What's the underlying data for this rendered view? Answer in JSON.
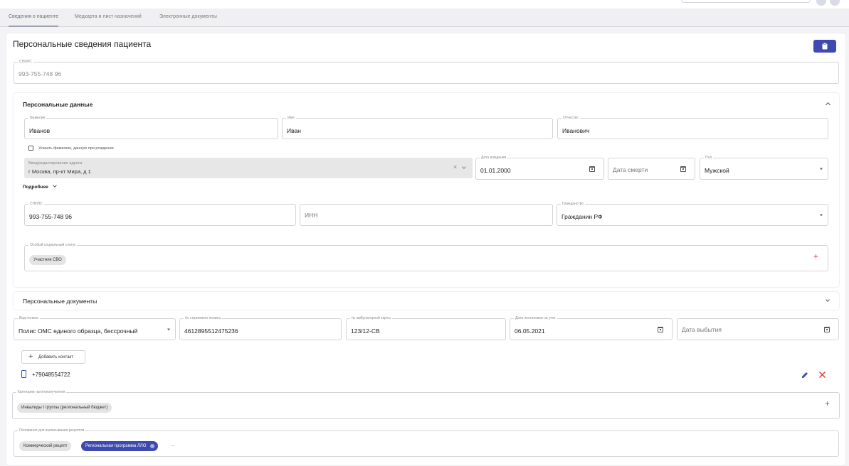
{
  "tabs": [
    "Сведения о пациенте",
    "Медкарта и лист назначений",
    "Электронные документы"
  ],
  "page_title": "Персональные сведения пациента",
  "snils_top": {
    "label": "СНИЛС",
    "value": "993-755-748 96"
  },
  "personal_data": {
    "title": "Персональные данные",
    "surname": {
      "label": "Фамилия",
      "value": "Иванов"
    },
    "name": {
      "label": "Имя",
      "value": "Иван"
    },
    "patronymic": {
      "label": "Отчество",
      "value": "Иванович"
    },
    "birth_name_checkbox": "Указать фамилию, данную при рождении",
    "address": {
      "label": "Ввод/редактирование адреса",
      "value": "г Москва, пр-кт Мира, д 1"
    },
    "birth_date": {
      "label": "Дата рождения",
      "value": "01.01.2000"
    },
    "death_date": {
      "placeholder": "Дата смерти"
    },
    "gender": {
      "label": "Пол",
      "value": "Мужской"
    },
    "more_link": "Подробнее",
    "snils": {
      "label": "СНИЛС",
      "value": "993-755-748 96"
    },
    "inn": {
      "placeholder": "ИНН"
    },
    "citizenship": {
      "label": "Гражданство",
      "value": "Гражданин РФ"
    },
    "social_status": {
      "label": "Особый социальный статус",
      "chips": [
        "Участник СВО"
      ]
    }
  },
  "documents": {
    "title": "Персональные документы"
  },
  "policy": {
    "type": {
      "label": "Вид полиса",
      "value": "Полис ОМС единого образца, бессрочный"
    },
    "number": {
      "label": "№ страхового полиса",
      "value": "4612895512475236"
    },
    "card": {
      "label": "№ амбулаторной карты",
      "value": "123/12-СВ"
    },
    "reg_date": {
      "label": "Дата постановки на учет",
      "value": "06.05.2021"
    },
    "leave_date": {
      "placeholder": "Дата выбытия"
    }
  },
  "add_contact": "Добавить контакт",
  "contact_phone": "+79048554722",
  "benefit_categories": {
    "label": "Категории льготополучателя",
    "chips": [
      "Инвалиды I группы (региональный бюджет)"
    ]
  },
  "prescription_grounds": {
    "label": "Основания для выписывания рецептов",
    "chips": [
      "Коммерческий рецепт",
      "Региональная программа ЛЛО"
    ],
    "more": "..."
  },
  "colors": {
    "primary": "#3f4ab0",
    "plus": "#e0336a",
    "delete": "#e03a3a",
    "chip": "#e4e4e4"
  },
  "icons": [
    "clipboard-icon",
    "calendar-icon",
    "chevron-down-icon",
    "chevron-up-icon",
    "plus-icon",
    "phone-icon",
    "edit-icon",
    "delete-icon",
    "clear-icon"
  ]
}
